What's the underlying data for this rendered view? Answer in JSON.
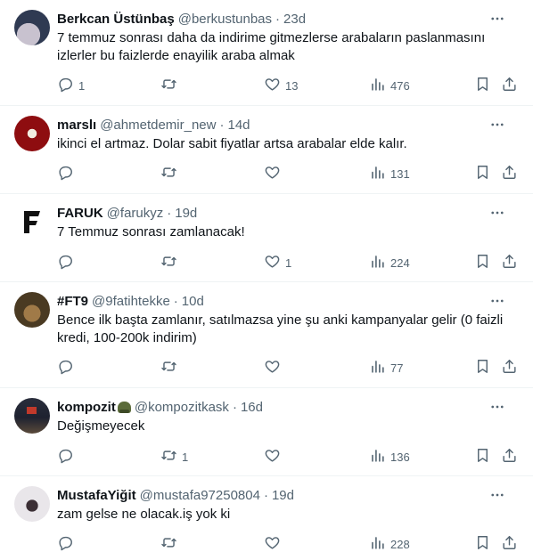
{
  "tweets": [
    {
      "name": "Berkcan Üstünbaş",
      "handle": "@berkustunbas",
      "time": "23d",
      "text": "7 temmuz sonrası daha da indirime gitmezlerse arabaların paslanmasını izlerler bu faizlerde enayilik araba almak",
      "replies": "1",
      "retweets": "",
      "likes": "13",
      "views": "476",
      "avatar_colors": [
        "#2f3a52",
        "#c8c2cf"
      ]
    },
    {
      "name": "marslı",
      "handle": "@ahmetdemir_new",
      "time": "14d",
      "text": "ikinci el artmaz. Dolar sabit fiyatlar artsa arabalar elde kalır.",
      "replies": "",
      "retweets": "",
      "likes": "",
      "views": "131",
      "avatar_colors": [
        "#8e0d10",
        "#d9d0c0"
      ]
    },
    {
      "name": "FARUK",
      "handle": "@farukyz",
      "time": "19d",
      "text": "7 Temmuz sonrası zamlanacak!",
      "replies": "",
      "retweets": "",
      "likes": "1",
      "views": "224",
      "avatar_colors": [
        "#ffffff",
        "#111111"
      ]
    },
    {
      "name": "#FT9",
      "handle": "@9fatihtekke",
      "time": "10d",
      "text": "Bence ilk başta zamlanır, satılmazsa yine şu anki kampanyalar gelir (0 faizli kredi, 100-200k indirim)",
      "replies": "",
      "retweets": "",
      "likes": "",
      "views": "77",
      "avatar_colors": [
        "#4a3a22",
        "#d9b04a"
      ]
    },
    {
      "name": "kompozit",
      "handle": "@kompozitkask",
      "time": "16d",
      "text": "Değişmeyecek",
      "replies": "",
      "retweets": "1",
      "likes": "",
      "views": "136",
      "avatar_colors": [
        "#1e2230",
        "#c0392b"
      ]
    },
    {
      "name": "MustafaYiğit",
      "handle": "@mustafa97250804",
      "time": "19d",
      "text": "zam gelse ne olacak.iş yok ki",
      "replies": "",
      "retweets": "",
      "likes": "",
      "views": "228",
      "avatar_colors": [
        "#e9e6ea",
        "#3b2f35"
      ]
    }
  ],
  "icons": {
    "reply": "reply-icon",
    "retweet": "retweet-icon",
    "like": "heart-icon",
    "views": "views-icon",
    "bookmark": "bookmark-icon",
    "share": "share-icon",
    "more": "more-icon"
  },
  "colors": {
    "text": "#0f1419",
    "secondary": "#536471",
    "divider": "#eff3f4"
  }
}
